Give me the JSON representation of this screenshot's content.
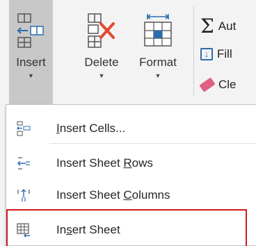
{
  "ribbon": {
    "insert": {
      "label": "Insert",
      "caret": "▼"
    },
    "delete": {
      "label": "Delete",
      "caret": "▼"
    },
    "format": {
      "label": "Format",
      "caret": "▼"
    },
    "autosum_label": "Aut",
    "fill_label": "Fill",
    "clear_label": "Cle"
  },
  "menu": {
    "items": [
      {
        "pre": "",
        "u": "I",
        "post": "nsert Cells..."
      },
      {
        "pre": "Insert Sheet ",
        "u": "R",
        "post": "ows"
      },
      {
        "pre": "Insert Sheet ",
        "u": "C",
        "post": "olumns"
      },
      {
        "pre": "In",
        "u": "s",
        "post": "ert Sheet"
      }
    ]
  },
  "colors": {
    "highlight": "#d11a1a",
    "accent_blue": "#2b6cb0",
    "insert_bg": "#c8c8c8"
  }
}
